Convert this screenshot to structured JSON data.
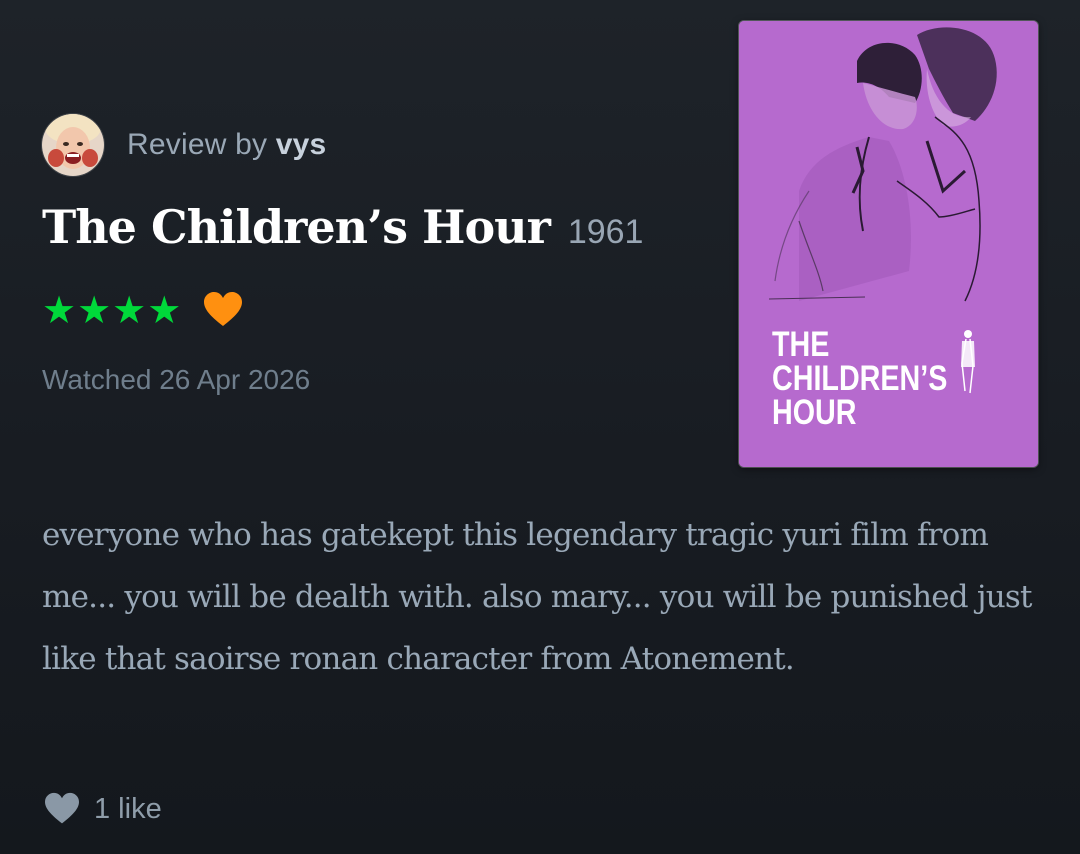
{
  "reviewer": {
    "prefix": "Review by ",
    "username": "vys",
    "avatar_icon": "avatar"
  },
  "film": {
    "title": "The Children’s Hour",
    "year": "1961"
  },
  "rating": {
    "stars_text": "★★★★",
    "stars": 4,
    "max_stars": 5,
    "liked": true,
    "star_color": "#00d93a",
    "heart_color": "#ff9010"
  },
  "watched": "Watched 26 Apr 2026",
  "poster": {
    "title_lines": [
      "THE",
      "CHILDREN’S",
      "HOUR"
    ],
    "background": "#b66ace"
  },
  "review_text": "everyone who has gatekept this legendary tragic yuri film from me... you will be dealth with. also mary... you will be punished just like that saoirse ronan character from Atonement.",
  "likes": {
    "count_label": "1 like",
    "icon": "heart-icon"
  }
}
